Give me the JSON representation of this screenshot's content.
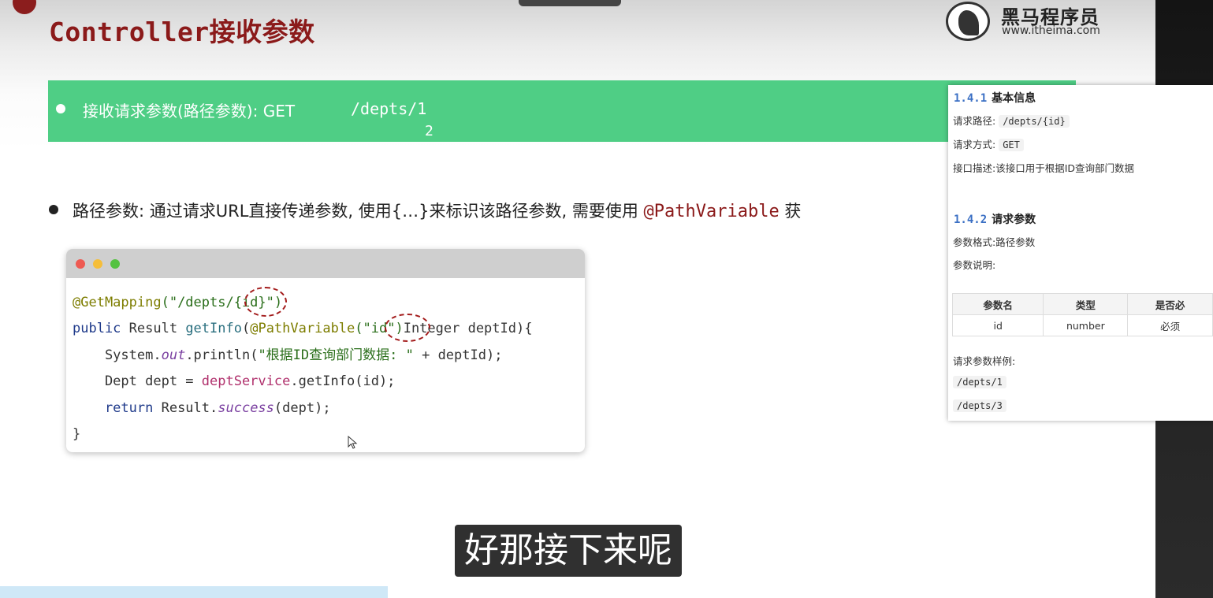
{
  "slide": {
    "title": "Controller接收参数",
    "logo": {
      "name": "黑马程序员",
      "url": "www.itheima.com"
    },
    "banner": {
      "text": "接收请求参数(路径参数): GET",
      "path_line1": "/depts/1",
      "path_line2": "2"
    },
    "bullet": {
      "text": "路径参数: 通过请求URL直接传递参数, 使用{…}来标识该路径参数, 需要使用",
      "annotation": "@PathVariable",
      "tail": "获"
    },
    "code": {
      "line1_ann": "@GetMapping",
      "line1_str": "(\"/depts/{id}\")",
      "line2_kw": "public",
      "line2_a": " Result ",
      "line2_fn": "getInfo",
      "line2_b": "(",
      "line2_ann": "@PathVariable",
      "line2_str": "(\"id\")",
      "line2_c": "Integer deptId){",
      "line3_a": "    System.",
      "line3_it": "out",
      "line3_b": ".println(",
      "line3_str": "\"根据ID查询部门数据: \"",
      "line3_c": " + deptId);",
      "line4_a": "    Dept dept = ",
      "line4_svc": "deptService",
      "line4_b": ".getInfo(id);",
      "line5_kw": "    return",
      "line5_a": " Result.",
      "line5_it": "success",
      "line5_b": "(dept);",
      "line6": "}"
    }
  },
  "doc": {
    "h1_num": "1.4.1",
    "h1": "基本信息",
    "req_path_label": "请求路径:",
    "req_path": "/depts/{id}",
    "req_method_label": "请求方式:",
    "req_method": "GET",
    "desc_label": "接口描述:",
    "desc": "该接口用于根据ID查询部门数据",
    "h2_num": "1.4.2",
    "h2": "请求参数",
    "format_label": "参数格式:",
    "format": "路径参数",
    "explain_label": "参数说明:",
    "table": {
      "headers": [
        "参数名",
        "类型",
        "是否必"
      ],
      "row": [
        "id",
        "number",
        "必须"
      ]
    },
    "example_label": "请求参数样例:",
    "example1": "/depts/1",
    "example2": "/depts/3"
  },
  "subtitle": "好那接下来呢"
}
